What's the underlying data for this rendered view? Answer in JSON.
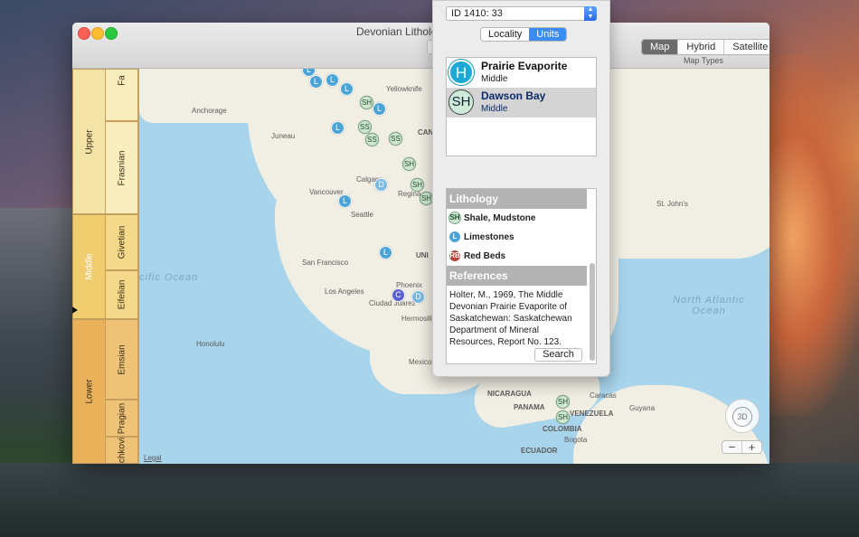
{
  "window": {
    "title": "Devonian Lithologic"
  },
  "map_types": {
    "options": [
      "Map",
      "Hybrid",
      "Satellite"
    ],
    "selected": "Map",
    "caption": "Map Types"
  },
  "strat_column": {
    "series": [
      {
        "label": "Upper",
        "color": "#f4e3a6"
      },
      {
        "label": "Middle",
        "color": "#f0cd6e"
      },
      {
        "label": "Lower",
        "color": "#e9b15a"
      }
    ],
    "stages": [
      {
        "label": "Fa",
        "color": "#f9edbe"
      },
      {
        "label": "Frasnian",
        "color": "#f9edbe"
      },
      {
        "label": "Givetian",
        "color": "#f4d98a"
      },
      {
        "label": "Eifelian",
        "color": "#f4d98a"
      },
      {
        "label": "Emsian",
        "color": "#eec377"
      },
      {
        "label": "Pragian",
        "color": "#eec377"
      },
      {
        "label": "Lochkovian",
        "color": "#eec377"
      }
    ],
    "selected_series": "Middle"
  },
  "map": {
    "labels": [
      "Anchorage",
      "Juneau",
      "Yellowknife",
      "CAN",
      "Calgary",
      "Regina",
      "Vancouver",
      "Seattle",
      "San Francisco",
      "UNI",
      "Los Angeles",
      "Phoenix",
      "Ciudad Juarez",
      "Hermosillo",
      "Honolulu",
      "Mexico",
      "St. John's",
      "NICARAGUA",
      "PANAMA",
      "VENEZUELA",
      "Guyana",
      "COLOMBIA",
      "ECUADOR",
      "Caracas",
      "Bogota"
    ],
    "oceans": [
      "cific Ocean",
      "North Atlantic Ocean"
    ],
    "pins": [
      {
        "type": "L",
        "label": "L"
      },
      {
        "type": "L",
        "label": "L"
      },
      {
        "type": "L",
        "label": "L"
      },
      {
        "type": "L",
        "label": "L"
      },
      {
        "type": "SH",
        "label": "SH"
      },
      {
        "type": "L",
        "label": "L"
      },
      {
        "type": "SS",
        "label": "SS"
      },
      {
        "type": "SS",
        "label": "SS"
      },
      {
        "type": "SS",
        "label": "SS"
      },
      {
        "type": "L",
        "label": "L"
      },
      {
        "type": "SH",
        "label": "SH"
      },
      {
        "type": "D",
        "label": "D"
      },
      {
        "type": "SH",
        "label": "SH"
      },
      {
        "type": "SH",
        "label": "SH"
      },
      {
        "type": "L",
        "label": "L"
      },
      {
        "type": "L",
        "label": "L"
      },
      {
        "type": "C",
        "label": "C"
      },
      {
        "type": "D",
        "label": "D"
      },
      {
        "type": "SH",
        "label": "SH"
      },
      {
        "type": "SH",
        "label": "SH"
      }
    ],
    "legal": "Legal",
    "compass_label": "3D",
    "zoom_out": "−",
    "zoom_in": "+"
  },
  "panel": {
    "id_select": "ID 1410: 33",
    "view_tabs": [
      "Locality",
      "Units"
    ],
    "view_selected": "Units",
    "units": [
      {
        "badge": "H",
        "name": "Prairie Evaporite",
        "age": "Middle",
        "selected": false
      },
      {
        "badge": "SH",
        "name": "Dawson Bay",
        "age": "Middle",
        "selected": true
      }
    ],
    "lithology_header": "Lithology",
    "lithology": [
      {
        "badge": "SH",
        "name": "Shale, Mudstone"
      },
      {
        "badge": "L",
        "name": "Limestones"
      },
      {
        "badge": "RB",
        "name": "Red Beds"
      }
    ],
    "references_header": "References",
    "reference_text": "Holter, M., 1969, The Middle Devonian Prairie Evaporite of Saskatchewan: Saskatchewan Department of Mineral Resources, Report No. 123.",
    "search_label": "Search"
  }
}
